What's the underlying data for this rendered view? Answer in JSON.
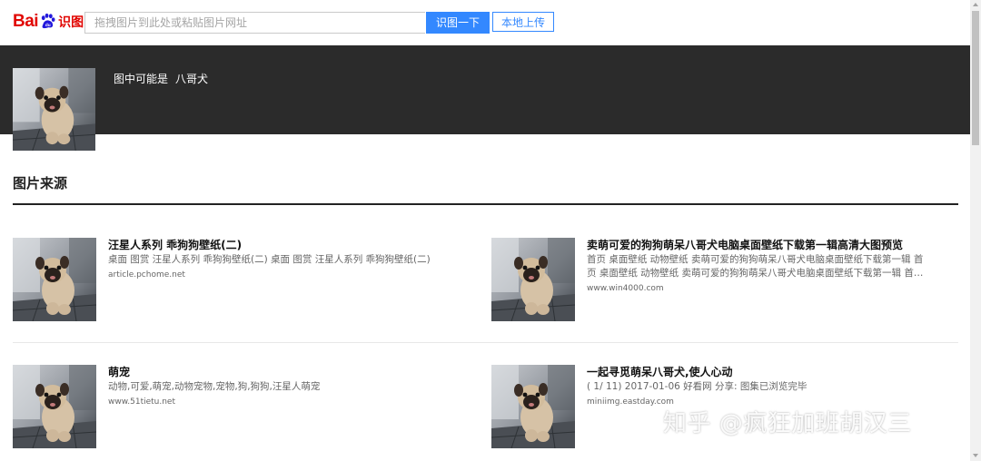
{
  "header": {
    "logo_text": "Bai",
    "logo_suffix": "识图",
    "search_placeholder": "拖拽图片到此处或粘贴图片网址",
    "search_button": "识图一下",
    "upload_button": "本地上传"
  },
  "guess": {
    "label": "图中可能是",
    "answer": "八哥犬"
  },
  "section": {
    "title": "图片来源"
  },
  "results": [
    {
      "title": "汪星人系列 乖狗狗壁纸(二)",
      "desc": "桌面 图赏 汪星人系列 乖狗狗壁纸(二) 桌面 图赏 汪星人系列 乖狗狗壁纸(二)",
      "site": "article.pchome.net"
    },
    {
      "title": "卖萌可爱的狗狗萌呆八哥犬电脑桌面壁纸下载第一辑高清大图预览",
      "desc": "首页 桌面壁纸 动物壁纸 卖萌可爱的狗狗萌呆八哥犬电脑桌面壁纸下载第一辑 首页 桌面壁纸 动物壁纸 卖萌可爱的狗狗萌呆八哥犬电脑桌面壁纸下载第一辑 首页 桌面壁纸 动...",
      "site": "www.win4000.com"
    },
    {
      "title": "萌宠",
      "desc": "动物,可爱,萌宠,动物宠物,宠物,狗,狗狗,汪星人萌宠",
      "site": "www.51tietu.net"
    },
    {
      "title": "一起寻觅萌呆八哥犬,使人心动",
      "desc": "( 1/ 11) 2017-01-06 好看网 分享: 图集已浏览完毕",
      "site": "miniimg.eastday.com"
    }
  ],
  "watermark": "知乎 @疯狂加班胡汉三",
  "colors": {
    "brand_red": "#e10602",
    "accent_blue": "#3388ff",
    "dark_band": "#2b2b2b"
  },
  "icons": {
    "logo_paw": "paw-icon",
    "thumbnail": "pug-photo"
  }
}
